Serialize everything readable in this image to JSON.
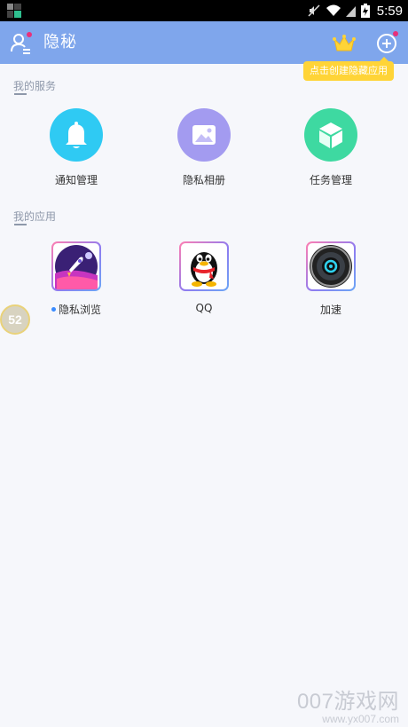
{
  "status_bar": {
    "time": "5:59",
    "icons": [
      "muted-icon",
      "wifi-icon",
      "signal-icon",
      "battery-icon"
    ]
  },
  "app_bar": {
    "title": "隐秘",
    "background_color": "#7fa6ec",
    "icons": [
      "user-icon",
      "crown-icon",
      "add-circle-icon"
    ]
  },
  "tooltip": {
    "text": "点击创建隐藏应用",
    "color": "#ffd437"
  },
  "services": {
    "title": "我的服务",
    "items": [
      {
        "label": "通知管理",
        "icon": "bell-icon",
        "color": "#2fcaf3"
      },
      {
        "label": "隐私相册",
        "icon": "photo-icon",
        "color": "#a39bf0"
      },
      {
        "label": "任务管理",
        "icon": "cube-icon",
        "color": "#3ed9a1"
      }
    ]
  },
  "apps": {
    "title": "我的应用",
    "items": [
      {
        "label": "隐私浏览",
        "icon": "rocket-browser-icon",
        "has_dot": true
      },
      {
        "label": "QQ",
        "icon": "qq-penguin-icon",
        "has_dot": false
      },
      {
        "label": "加速",
        "icon": "speed-lens-icon",
        "has_dot": false
      }
    ]
  },
  "floating_badge": {
    "value": "52"
  },
  "watermark": {
    "line1": "007游戏网",
    "line2": "www.yx007.com"
  }
}
